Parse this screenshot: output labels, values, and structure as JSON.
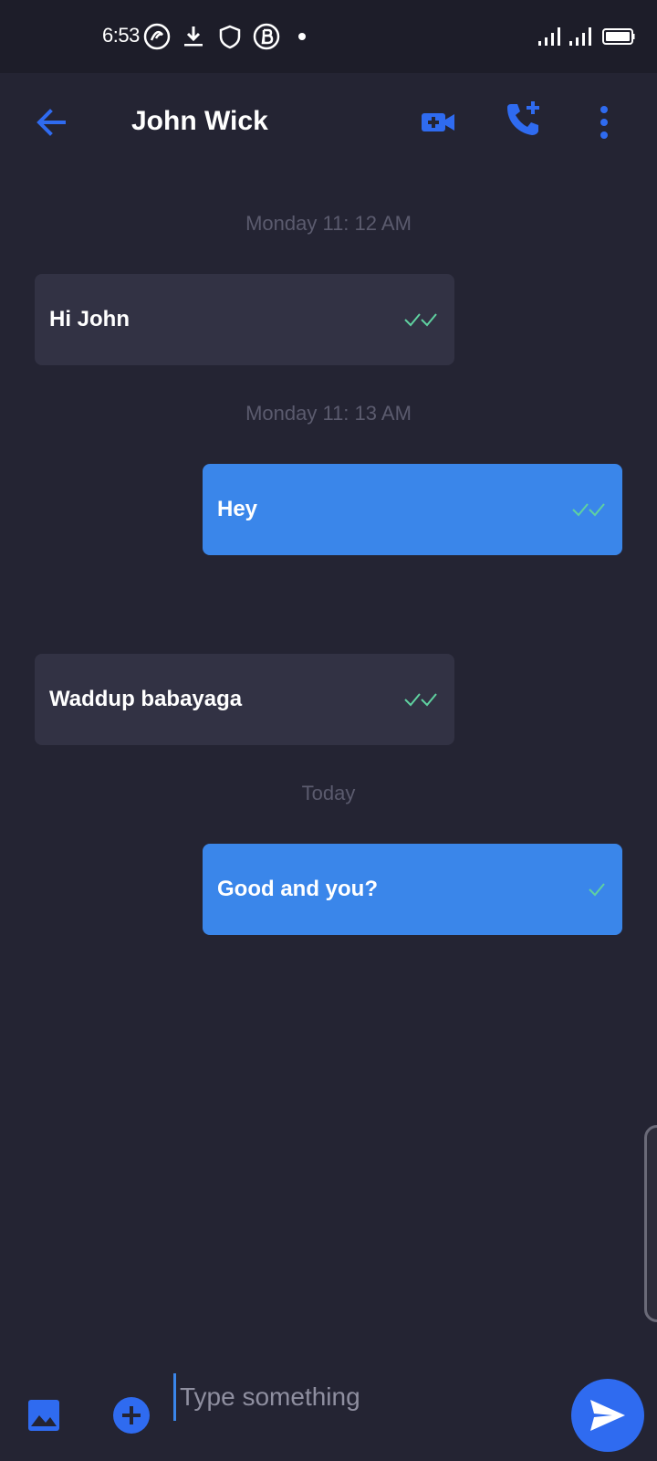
{
  "status_bar": {
    "time": "6:53"
  },
  "header": {
    "title": "John Wick"
  },
  "messages": [
    {
      "timestamp": "Monday 11: 12 AM",
      "text": "Hi John",
      "direction": "incoming",
      "ticks": "double"
    },
    {
      "timestamp": "Monday 11: 13 AM",
      "text": "Hey",
      "direction": "outgoing",
      "ticks": "double"
    },
    {
      "timestamp": "",
      "text": "Waddup babayaga",
      "direction": "incoming",
      "ticks": "double"
    },
    {
      "timestamp": "Today",
      "text": "Good and you?",
      "direction": "outgoing",
      "ticks": "single"
    }
  ],
  "composer": {
    "placeholder": "Type something",
    "value": ""
  },
  "colors": {
    "background": "#242433",
    "accent": "#2f6bf0",
    "outgoing_bubble": "#3a86ea",
    "incoming_bubble": "#323244",
    "tick": "#5fd1a0",
    "timestamp": "#5b5b6e"
  },
  "icons": {
    "back": "arrow-left-icon",
    "video": "video-add-icon",
    "call": "phone-add-icon",
    "more": "more-vert-icon",
    "gallery": "image-icon",
    "attach": "add-circle-icon",
    "send": "send-icon"
  }
}
